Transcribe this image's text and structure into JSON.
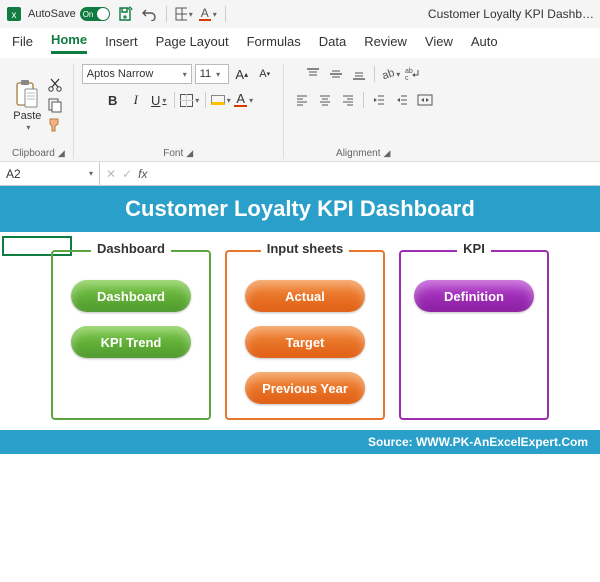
{
  "titlebar": {
    "autosave_label": "AutoSave",
    "autosave_state": "On",
    "doc_title": "Customer Loyalty KPI Dashb…"
  },
  "tabs": {
    "file": "File",
    "home": "Home",
    "insert": "Insert",
    "page_layout": "Page Layout",
    "formulas": "Formulas",
    "data": "Data",
    "review": "Review",
    "view": "View",
    "auto": "Auto"
  },
  "ribbon": {
    "clipboard": {
      "label": "Clipboard",
      "paste": "Paste"
    },
    "font": {
      "label": "Font",
      "name": "Aptos Narrow",
      "size": "11",
      "bold": "B",
      "italic": "I",
      "underline": "U",
      "fontcolor": "A"
    },
    "alignment": {
      "label": "Alignment"
    }
  },
  "fx": {
    "namebox": "A2",
    "fx_label": "fx"
  },
  "sheet": {
    "banner": "Customer Loyalty KPI Dashboard",
    "panels": {
      "dashboard": {
        "title": "Dashboard",
        "btn1": "Dashboard",
        "btn2": "KPI Trend"
      },
      "inputs": {
        "title": "Input sheets",
        "btn1": "Actual",
        "btn2": "Target",
        "btn3": "Previous Year"
      },
      "kpi": {
        "title": "KPI",
        "btn1": "Definition"
      }
    },
    "footer": "Source: WWW.PK-AnExcelExpert.Com"
  }
}
